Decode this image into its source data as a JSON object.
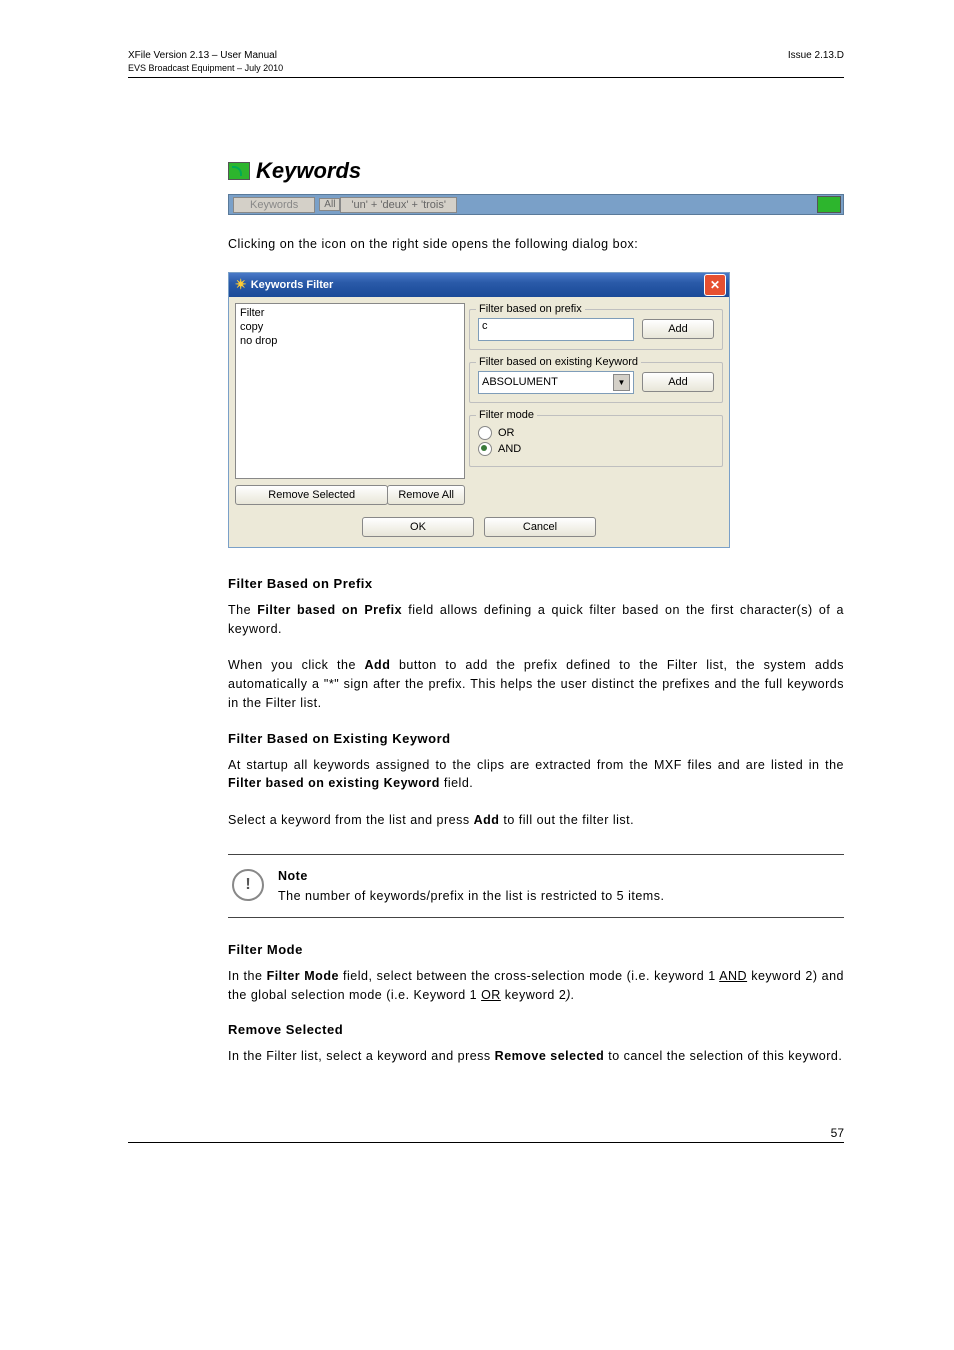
{
  "header": {
    "left": "XFile Version 2.13 – User Manual",
    "right": "Issue 2.13.D",
    "sub": "EVS Broadcast Equipment – July 2010"
  },
  "section": {
    "title": "Keywords"
  },
  "statusbar": {
    "keywords_btn": "Keywords",
    "all_btn": "All",
    "expr": "'un' + 'deux' + 'trois'"
  },
  "intro": "Clicking on the icon on the right side opens the following dialog box:",
  "dialog": {
    "title": "Keywords Filter",
    "list": [
      "Filter",
      "copy",
      "no drop"
    ],
    "remove_selected": "Remove Selected",
    "remove_all": "Remove All",
    "grp_prefix": {
      "label": "Filter based on prefix",
      "value": "c",
      "add": "Add"
    },
    "grp_existing": {
      "label": "Filter based on existing Keyword",
      "value": "ABSOLUMENT",
      "add": "Add"
    },
    "grp_mode": {
      "label": "Filter mode",
      "or": "OR",
      "and": "AND"
    },
    "ok": "OK",
    "cancel": "Cancel"
  },
  "h_prefix": "Filter Based on Prefix",
  "p_prefix1a": "The ",
  "p_prefix1b": "Filter based on Prefix",
  "p_prefix1c": " field allows defining a quick filter based on the first character(s) of a keyword.",
  "p_prefix2a": "When you click the ",
  "p_prefix2b": "Add",
  "p_prefix2c": " button to add the prefix defined to the Filter list, the system adds automatically a \"*\" sign after the prefix. This helps the user distinct the prefixes and the full keywords in the Filter list.",
  "h_existing": "Filter Based on Existing Keyword",
  "p_exist1a": "At startup all keywords assigned to the clips are extracted from the MXF files and are listed in the ",
  "p_exist1b": "Filter based on existing Keyword",
  "p_exist1c": " field.",
  "p_exist2a": "Select a keyword from the list and press ",
  "p_exist2b": "Add",
  "p_exist2c": " to fill out the filter list.",
  "note": {
    "title": "Note",
    "text": "The number of keywords/prefix in the list is restricted to 5 items."
  },
  "h_mode": "Filter Mode",
  "p_mode_a": "In the ",
  "p_mode_b": "Filter Mode",
  "p_mode_c": " field, select between the cross-selection mode (i.e. keyword 1 ",
  "p_mode_and": "AND",
  "p_mode_d": " keyword 2) and the global selection mode (i.e. Keyword 1 ",
  "p_mode_or": "OR",
  "p_mode_e": " keyword 2",
  "p_mode_f": ").",
  "h_remove": "Remove Selected",
  "p_remove_a": "In the Filter list, select a keyword and press ",
  "p_remove_b": "Remove selected",
  "p_remove_c": " to cancel the selection of this keyword.",
  "page_number": "57"
}
